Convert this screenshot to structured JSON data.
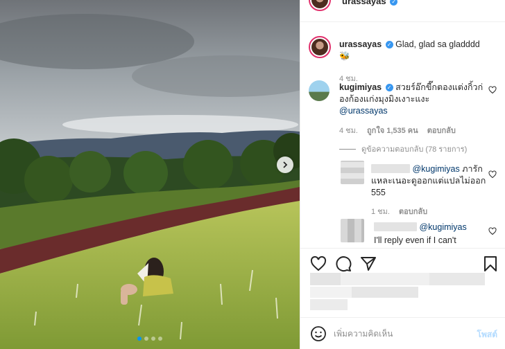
{
  "post": {
    "owner_username": "urassayas",
    "carousel": {
      "current_slide": 1,
      "total_slides": 4
    }
  },
  "caption": {
    "username": "urassayas",
    "text": "Glad, glad sa gladddd",
    "emoji": "🐝",
    "time": "4 ชม."
  },
  "comments": [
    {
      "username": "kugimiyas",
      "text": "สวยร์อ๊กขี๊กตองแต่งกิ้วก่องก้องแก่งมุงมิงเงาะแงะ",
      "mention": "@urassayas",
      "time": "4 ชม.",
      "likes": "ถูกใจ 1,535 คน",
      "reply_label": "ตอบกลับ",
      "view_replies": "ดูข้อความตอบกลับ (78 รายการ)"
    }
  ],
  "replies": [
    {
      "mention": "@kugimiyas",
      "text": "ภารักแหละเนอะดูออกแต่แปลไม่ออก 555",
      "time": "1 ชม.",
      "reply_label": "ตอบกลับ"
    },
    {
      "mention": "@kugimiyas",
      "text": "I'll reply even if I can't"
    }
  ],
  "add_comment": {
    "placeholder": "เพิ่มความคิดเห็น",
    "post_label": "โพสต์"
  },
  "icons": {
    "like": "heart-icon",
    "comment": "comment-icon",
    "share": "share-icon",
    "save": "bookmark-icon",
    "emoji": "emoji-icon",
    "next": "chevron-right-icon"
  },
  "colors": {
    "verified": "#3897f0",
    "mention": "#00376b",
    "active_dot": "#0095f6",
    "post_disabled": "#b3dbff"
  }
}
